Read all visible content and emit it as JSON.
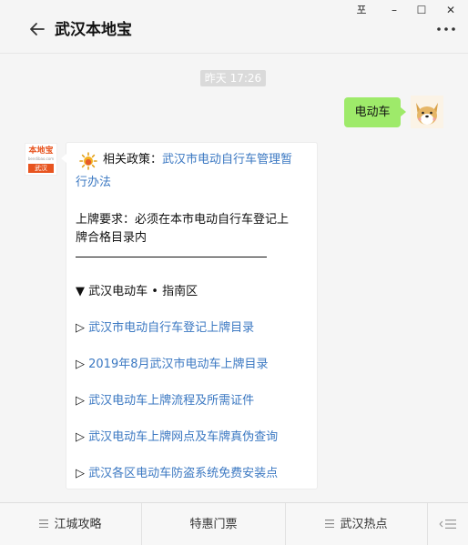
{
  "window": {
    "title": "武汉本地宝",
    "pin_glyph": "포",
    "minimize_glyph": "–",
    "maximize_glyph": "☐",
    "close_glyph": "✕"
  },
  "chat": {
    "timestamp": "昨天 17:26",
    "sent_message": "电动车",
    "card": {
      "policy_label": "相关政策：",
      "policy_link_1": "武汉市电动自行车管理暂",
      "policy_link_2": "行办法",
      "requirement_1": "上牌要求：必须在本市电动自行车登记上",
      "requirement_2": "牌合格目录内",
      "section_header": "▼ 武汉电动车 • 指南区",
      "link_arrow": "▷",
      "links": [
        "武汉市电动自行车登记上牌目录",
        "2019年8月武汉市电动车上牌目录",
        "武汉电动车上牌流程及所需证件",
        "武汉电动车上牌网点及车牌真伪查询",
        "武汉各区电动车防盗系统免费安装点"
      ]
    },
    "avatar": {
      "logo": "本地宝",
      "sub": "bendibao.com",
      "city": "武汉"
    }
  },
  "bottom_menu": {
    "items": [
      "江城攻略",
      "特惠门票",
      "武汉热点"
    ]
  },
  "icons": {
    "back": "arrow-left-icon",
    "more": "ellipsis-icon",
    "sun": "sun-icon",
    "menu": "hamburger-icon",
    "keyboard": "keyboard-switch-icon"
  },
  "colors": {
    "link": "#3b78c2",
    "sent_bubble": "#9eea6a",
    "brand": "#e8541f"
  }
}
